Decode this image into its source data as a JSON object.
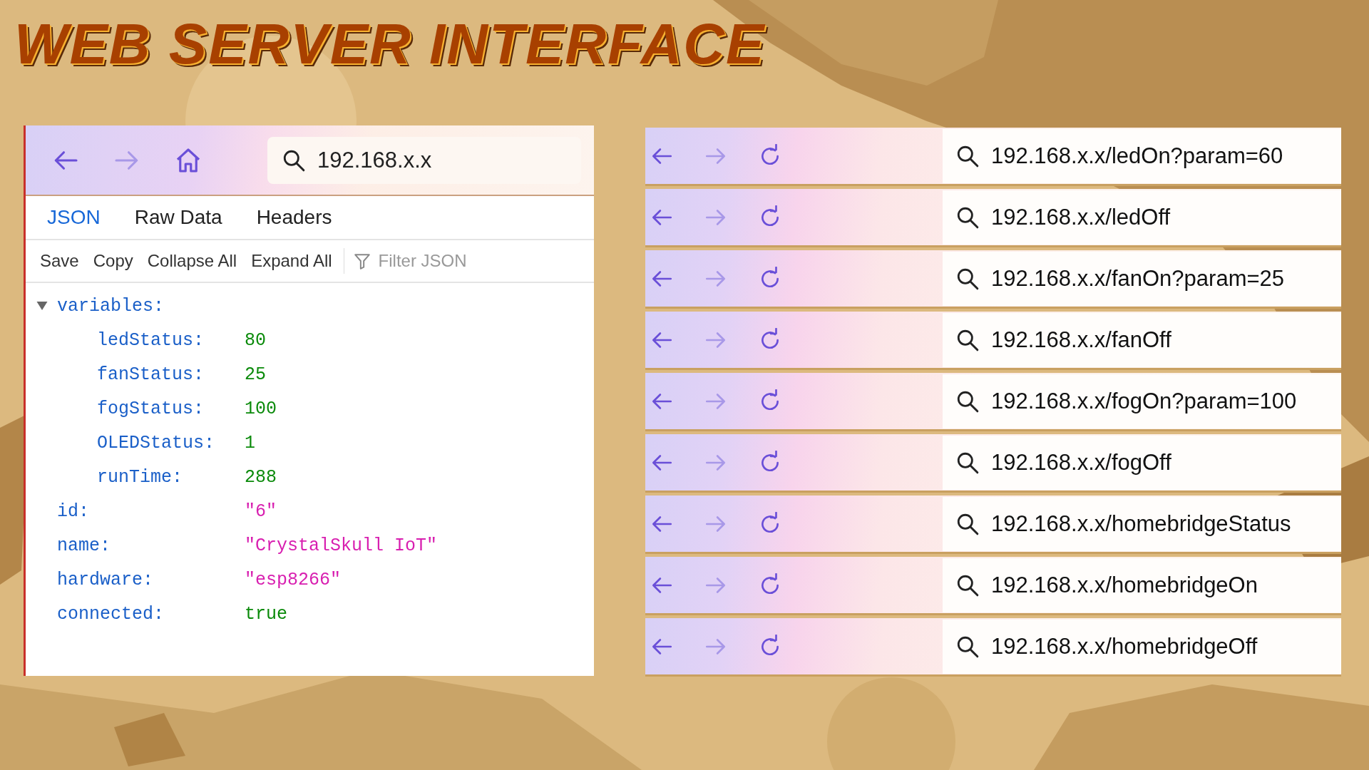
{
  "title": "WEB SERVER INTERFACE",
  "json_viewer": {
    "address": "192.168.x.x",
    "tabs": [
      {
        "label": "JSON",
        "selected": true
      },
      {
        "label": "Raw Data",
        "selected": false
      },
      {
        "label": "Headers",
        "selected": false
      }
    ],
    "toolbar": [
      "Save",
      "Copy",
      "Collapse All",
      "Expand All"
    ],
    "filter_placeholder": "Filter JSON",
    "tree": [
      {
        "key": "variables:",
        "expanded": true,
        "children": [
          {
            "key": "ledStatus:",
            "value": "80",
            "kind": "number"
          },
          {
            "key": "fanStatus:",
            "value": "25",
            "kind": "number"
          },
          {
            "key": "fogStatus:",
            "value": "100",
            "kind": "number"
          },
          {
            "key": "OLEDStatus:",
            "value": "1",
            "kind": "number"
          },
          {
            "key": "runTime:",
            "value": "288",
            "kind": "number"
          }
        ]
      },
      {
        "key": "id:",
        "value": "\"6\"",
        "kind": "string"
      },
      {
        "key": "name:",
        "value": "\"CrystalSkull IoT\"",
        "kind": "string"
      },
      {
        "key": "hardware:",
        "value": "\"esp8266\"",
        "kind": "string"
      },
      {
        "key": "connected:",
        "value": "true",
        "kind": "boolean"
      }
    ]
  },
  "requests": [
    {
      "url": "192.168.x.x/ledOn?param=60"
    },
    {
      "url": "192.168.x.x/ledOff"
    },
    {
      "url": "192.168.x.x/fanOn?param=25"
    },
    {
      "url": "192.168.x.x/fanOff"
    },
    {
      "url": "192.168.x.x/fogOn?param=100"
    },
    {
      "url": "192.168.x.x/fogOff"
    },
    {
      "url": "192.168.x.x/homebridgeStatus"
    },
    {
      "url": "192.168.x.x/homebridgeOn"
    },
    {
      "url": "192.168.x.x/homebridgeOff"
    }
  ]
}
